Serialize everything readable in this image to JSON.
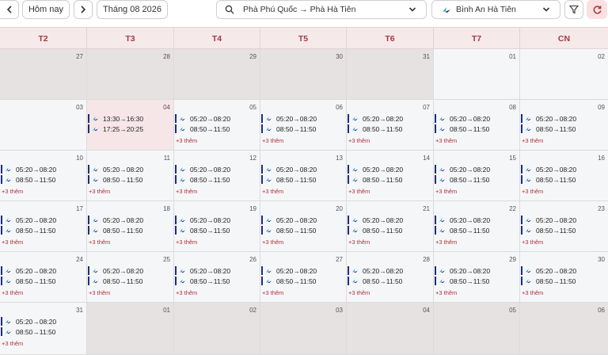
{
  "toolbar": {
    "today_label": "Hôm nay",
    "month_label": "Tháng 08 2026",
    "route_label": "Phà Phú Quốc → Phà Hà Tiên",
    "carrier_label": "Bình An Hà Tiên"
  },
  "weekdays": [
    "T2",
    "T3",
    "T4",
    "T5",
    "T6",
    "T7",
    "CN"
  ],
  "more_label": "+3 thêm",
  "weeks": [
    [
      {
        "day": "27",
        "other": true,
        "trips": [],
        "more": false
      },
      {
        "day": "28",
        "other": true,
        "trips": [],
        "more": false
      },
      {
        "day": "29",
        "other": true,
        "trips": [],
        "more": false
      },
      {
        "day": "30",
        "other": true,
        "trips": [],
        "more": false
      },
      {
        "day": "31",
        "other": true,
        "trips": [],
        "more": false
      },
      {
        "day": "01",
        "other": false,
        "trips": [],
        "more": false
      },
      {
        "day": "02",
        "other": false,
        "trips": [],
        "more": false
      }
    ],
    [
      {
        "day": "03",
        "trips": [],
        "more": false
      },
      {
        "day": "04",
        "today": true,
        "trips": [
          "13:30→16:30",
          "17:25→20:25"
        ],
        "more": false
      },
      {
        "day": "05",
        "trips": [
          "05:20→08:20",
          "08:50→11:50"
        ],
        "more": true
      },
      {
        "day": "06",
        "trips": [
          "05:20→08:20",
          "08:50→11:50"
        ],
        "more": true
      },
      {
        "day": "07",
        "trips": [
          "05:20→08:20",
          "08:50→11:50"
        ],
        "more": true
      },
      {
        "day": "08",
        "trips": [
          "05:20→08:20",
          "08:50→11:50"
        ],
        "more": true
      },
      {
        "day": "09",
        "trips": [
          "05:20→08:20",
          "08:50→11:50"
        ],
        "more": true
      }
    ],
    [
      {
        "day": "10",
        "trips": [
          "05:20→08:20",
          "08:50→11:50"
        ],
        "more": true
      },
      {
        "day": "11",
        "trips": [
          "05:20→08:20",
          "08:50→11:50"
        ],
        "more": true
      },
      {
        "day": "12",
        "trips": [
          "05:20→08:20",
          "08:50→11:50"
        ],
        "more": true
      },
      {
        "day": "13",
        "trips": [
          "05:20→08:20",
          "08:50→11:50"
        ],
        "more": true
      },
      {
        "day": "14",
        "trips": [
          "05:20→08:20",
          "08:50→11:50"
        ],
        "more": true
      },
      {
        "day": "15",
        "trips": [
          "05:20→08:20",
          "08:50→11:50"
        ],
        "more": true
      },
      {
        "day": "16",
        "trips": [
          "05:20→08:20",
          "08:50→11:50"
        ],
        "more": true
      }
    ],
    [
      {
        "day": "17",
        "trips": [
          "05:20→08:20",
          "08:50→11:50"
        ],
        "more": true
      },
      {
        "day": "18",
        "trips": [
          "05:20→08:20",
          "08:50→11:50"
        ],
        "more": true
      },
      {
        "day": "19",
        "trips": [
          "05:20→08:20",
          "08:50→11:50"
        ],
        "more": true
      },
      {
        "day": "20",
        "trips": [
          "05:20→08:20",
          "08:50→11:50"
        ],
        "more": true
      },
      {
        "day": "21",
        "trips": [
          "05:20→08:20",
          "08:50→11:50"
        ],
        "more": true
      },
      {
        "day": "22",
        "trips": [
          "05:20→08:20",
          "08:50→11:50"
        ],
        "more": true
      },
      {
        "day": "23",
        "trips": [
          "05:20→08:20",
          "08:50→11:50"
        ],
        "more": true
      }
    ],
    [
      {
        "day": "24",
        "trips": [
          "05:20→08:20",
          "08:50→11:50"
        ],
        "more": true
      },
      {
        "day": "25",
        "trips": [
          "05:20→08:20",
          "08:50→11:50"
        ],
        "more": true
      },
      {
        "day": "26",
        "trips": [
          "05:20→08:20",
          "08:50→11:50"
        ],
        "more": true
      },
      {
        "day": "27",
        "trips": [
          "05:20→08:20",
          "08:50→11:50"
        ],
        "more": true
      },
      {
        "day": "28",
        "trips": [
          "05:20→08:20",
          "08:50→11:50"
        ],
        "more": true
      },
      {
        "day": "29",
        "trips": [
          "05:20→08:20",
          "08:50→11:50"
        ],
        "more": true
      },
      {
        "day": "30",
        "trips": [
          "05:20→08:20",
          "08:50→11:50"
        ],
        "more": true
      }
    ],
    [
      {
        "day": "31",
        "trips": [
          "05:20→08:20",
          "08:50→11:50"
        ],
        "more": true
      },
      {
        "day": "01",
        "other": true,
        "trips": [],
        "more": false
      },
      {
        "day": "02",
        "other": true,
        "trips": [],
        "more": false
      },
      {
        "day": "03",
        "other": true,
        "trips": [],
        "more": false
      },
      {
        "day": "04",
        "other": true,
        "trips": [],
        "more": false
      },
      {
        "day": "05",
        "other": true,
        "trips": [],
        "more": false
      },
      {
        "day": "06",
        "other": true,
        "trips": [],
        "more": false
      }
    ]
  ]
}
